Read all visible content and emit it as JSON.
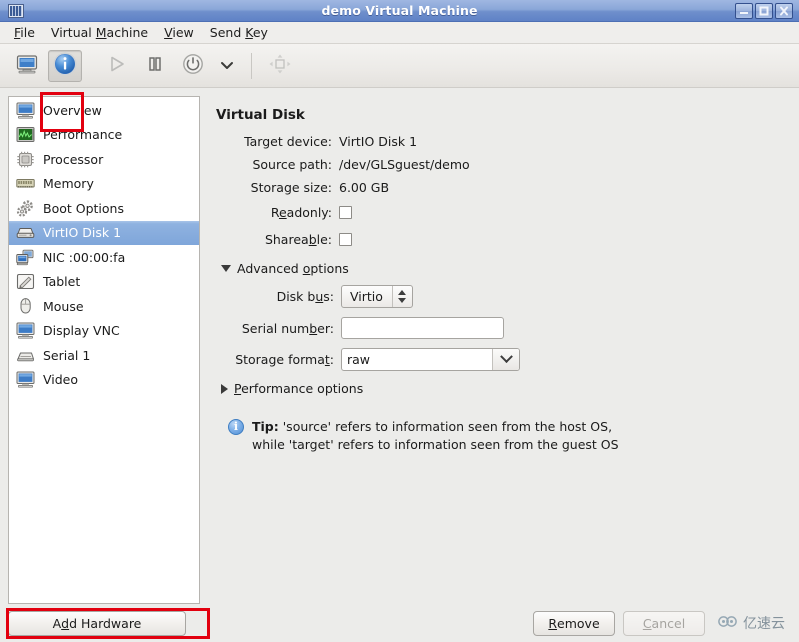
{
  "window": {
    "title": "demo Virtual Machine",
    "icon": "vm-window-icon",
    "buttons": {
      "minimize": "minimize-icon",
      "maximize": "maximize-icon",
      "close": "close-icon"
    }
  },
  "menubar": {
    "items": [
      {
        "label": "File",
        "mnemonic": "F",
        "pre": "",
        "post": "ile"
      },
      {
        "label": "Virtual Machine",
        "mnemonic": "M",
        "pre": "Virtual ",
        "post": "achine"
      },
      {
        "label": "View",
        "mnemonic": "V",
        "pre": "",
        "post": "iew"
      },
      {
        "label": "Send Key",
        "mnemonic": "K",
        "pre": "Send ",
        "post": "ey"
      }
    ]
  },
  "toolbar": {
    "items": [
      {
        "name": "show-console-button",
        "icon": "monitor-icon",
        "active": false
      },
      {
        "name": "show-details-button",
        "icon": "info-icon",
        "active": true
      },
      {
        "name": "run-button",
        "icon": "play-icon",
        "active": false
      },
      {
        "name": "pause-button",
        "icon": "pause-icon",
        "active": false
      },
      {
        "name": "shutdown-button",
        "icon": "power-icon",
        "active": false
      },
      {
        "name": "shutdown-menu-button",
        "icon": "chevron-down-icon",
        "active": false
      },
      {
        "name": "fullscreen-button",
        "icon": "fullscreen-icon",
        "active": false
      }
    ]
  },
  "sidebar": {
    "items": [
      {
        "label": "Overview",
        "icon": "monitor-icon",
        "selected": false
      },
      {
        "label": "Performance",
        "icon": "performance-graph-icon",
        "selected": false
      },
      {
        "label": "Processor",
        "icon": "cpu-chip-icon",
        "selected": false
      },
      {
        "label": "Memory",
        "icon": "memory-stick-icon",
        "selected": false
      },
      {
        "label": "Boot Options",
        "icon": "gears-icon",
        "selected": false
      },
      {
        "label": "VirtIO Disk 1",
        "icon": "harddisk-icon",
        "selected": true
      },
      {
        "label": "NIC :00:00:fa",
        "icon": "network-card-icon",
        "selected": false
      },
      {
        "label": "Tablet",
        "icon": "tablet-pen-icon",
        "selected": false
      },
      {
        "label": "Mouse",
        "icon": "mouse-icon",
        "selected": false
      },
      {
        "label": "Display VNC",
        "icon": "monitor-icon",
        "selected": false
      },
      {
        "label": "Serial 1",
        "icon": "serial-port-icon",
        "selected": false
      },
      {
        "label": "Video",
        "icon": "monitor-icon",
        "selected": false
      }
    ]
  },
  "main": {
    "title": "Virtual Disk",
    "fields": {
      "target_device_label": "Target device:",
      "target_device_value": "VirtIO Disk 1",
      "source_path_label": "Source path:",
      "source_path_value": "/dev/GLSguest/demo",
      "storage_size_label": "Storage size:",
      "storage_size_value": "6.00 GB",
      "readonly_label_pre": "R",
      "readonly_label_mn": "e",
      "readonly_label_post": "adonly:",
      "readonly_checked": false,
      "shareable_label_pre": "Sharea",
      "shareable_label_mn": "b",
      "shareable_label_post": "le:",
      "shareable_checked": false
    },
    "advanced": {
      "expander_label_pre": "Advanced ",
      "expander_label_mn": "o",
      "expander_label_post": "ptions",
      "expanded": true,
      "disk_bus_label_pre": "Disk b",
      "disk_bus_label_mn": "u",
      "disk_bus_label_post": "s:",
      "disk_bus_value": "Virtio",
      "serial_number_label_pre": "Serial num",
      "serial_number_label_mn": "b",
      "serial_number_label_post": "er:",
      "serial_number_value": "",
      "serial_number_placeholder": "",
      "storage_format_label_pre": "Storage forma",
      "storage_format_label_mn": "t",
      "storage_format_label_post": ":",
      "storage_format_value": "raw",
      "performance_label_pre": "",
      "performance_label_mn": "P",
      "performance_label_post": "erformance options",
      "performance_expanded": false
    },
    "tip": {
      "prefix": "Tip:",
      "line1": " 'source' refers to information seen from the host OS,",
      "line2": "while 'target' refers to information seen from the guest OS"
    }
  },
  "bottom": {
    "add_hardware_pre": "A",
    "add_hardware_mn": "d",
    "add_hardware_post": "d Hardware",
    "remove_pre": "",
    "remove_mn": "R",
    "remove_post": "emove",
    "cancel_pre": "",
    "cancel_mn": "C",
    "cancel_post": "ancel",
    "cancel_disabled": true,
    "watermark": "亿速云"
  },
  "highlights": {
    "color": "#e2000f"
  }
}
